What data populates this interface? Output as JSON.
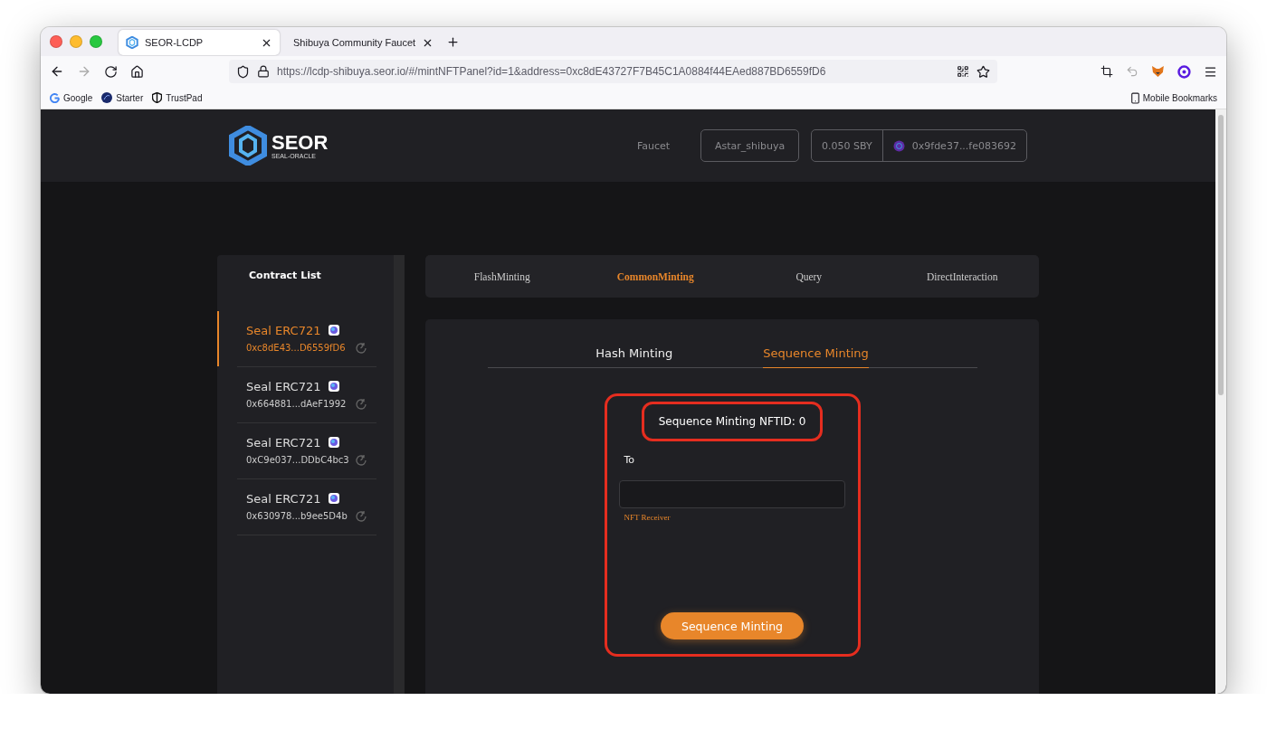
{
  "browser": {
    "tabs": [
      {
        "title": "SEOR-LCDP",
        "selected": true
      },
      {
        "title": "Shibuya Community Faucet",
        "selected": false
      }
    ],
    "url": "https://lcdp-shibuya.seor.io/#/mintNFTPanel?id=1&address=0xc8dE43727F7B45C1A0884f44EAed887BD6559fD6",
    "bookmarks": [
      {
        "label": "Google"
      },
      {
        "label": "Starter"
      },
      {
        "label": "TrustPad"
      }
    ],
    "mobile_bookmarks": "Mobile Bookmarks"
  },
  "header": {
    "logo": {
      "name": "SEOR",
      "tagline": "SEAL-ORACLE"
    },
    "faucet": "Faucet",
    "network": "Astar_shibuya",
    "balance": "0.050 SBY",
    "account": "0x9fde37...fe083692"
  },
  "sidebar": {
    "title": "Contract List",
    "contracts": [
      {
        "name": "Seal ERC721",
        "address": "0xc8dE43...D6559fD6",
        "selected": true
      },
      {
        "name": "Seal ERC721",
        "address": "0x664881...dAeF1992",
        "selected": false
      },
      {
        "name": "Seal ERC721",
        "address": "0xC9e037...DDbC4bc3",
        "selected": false
      },
      {
        "name": "Seal ERC721",
        "address": "0x630978...b9ee5D4b",
        "selected": false
      }
    ]
  },
  "main_tabs": [
    {
      "label": "FlashMinting",
      "selected": false
    },
    {
      "label": "CommonMinting",
      "selected": true
    },
    {
      "label": "Query",
      "selected": false
    },
    {
      "label": "DirectInteraction",
      "selected": false
    }
  ],
  "sub_tabs": [
    {
      "label": "Hash Minting",
      "selected": false
    },
    {
      "label": "Sequence Minting",
      "selected": true
    }
  ],
  "form": {
    "highlighted": true,
    "nftid": {
      "text": "Sequence Minting NFTID: 0",
      "highlighted": true
    },
    "to_label": "To",
    "helper": "NFT Receiver",
    "button": "Sequence Minting"
  }
}
